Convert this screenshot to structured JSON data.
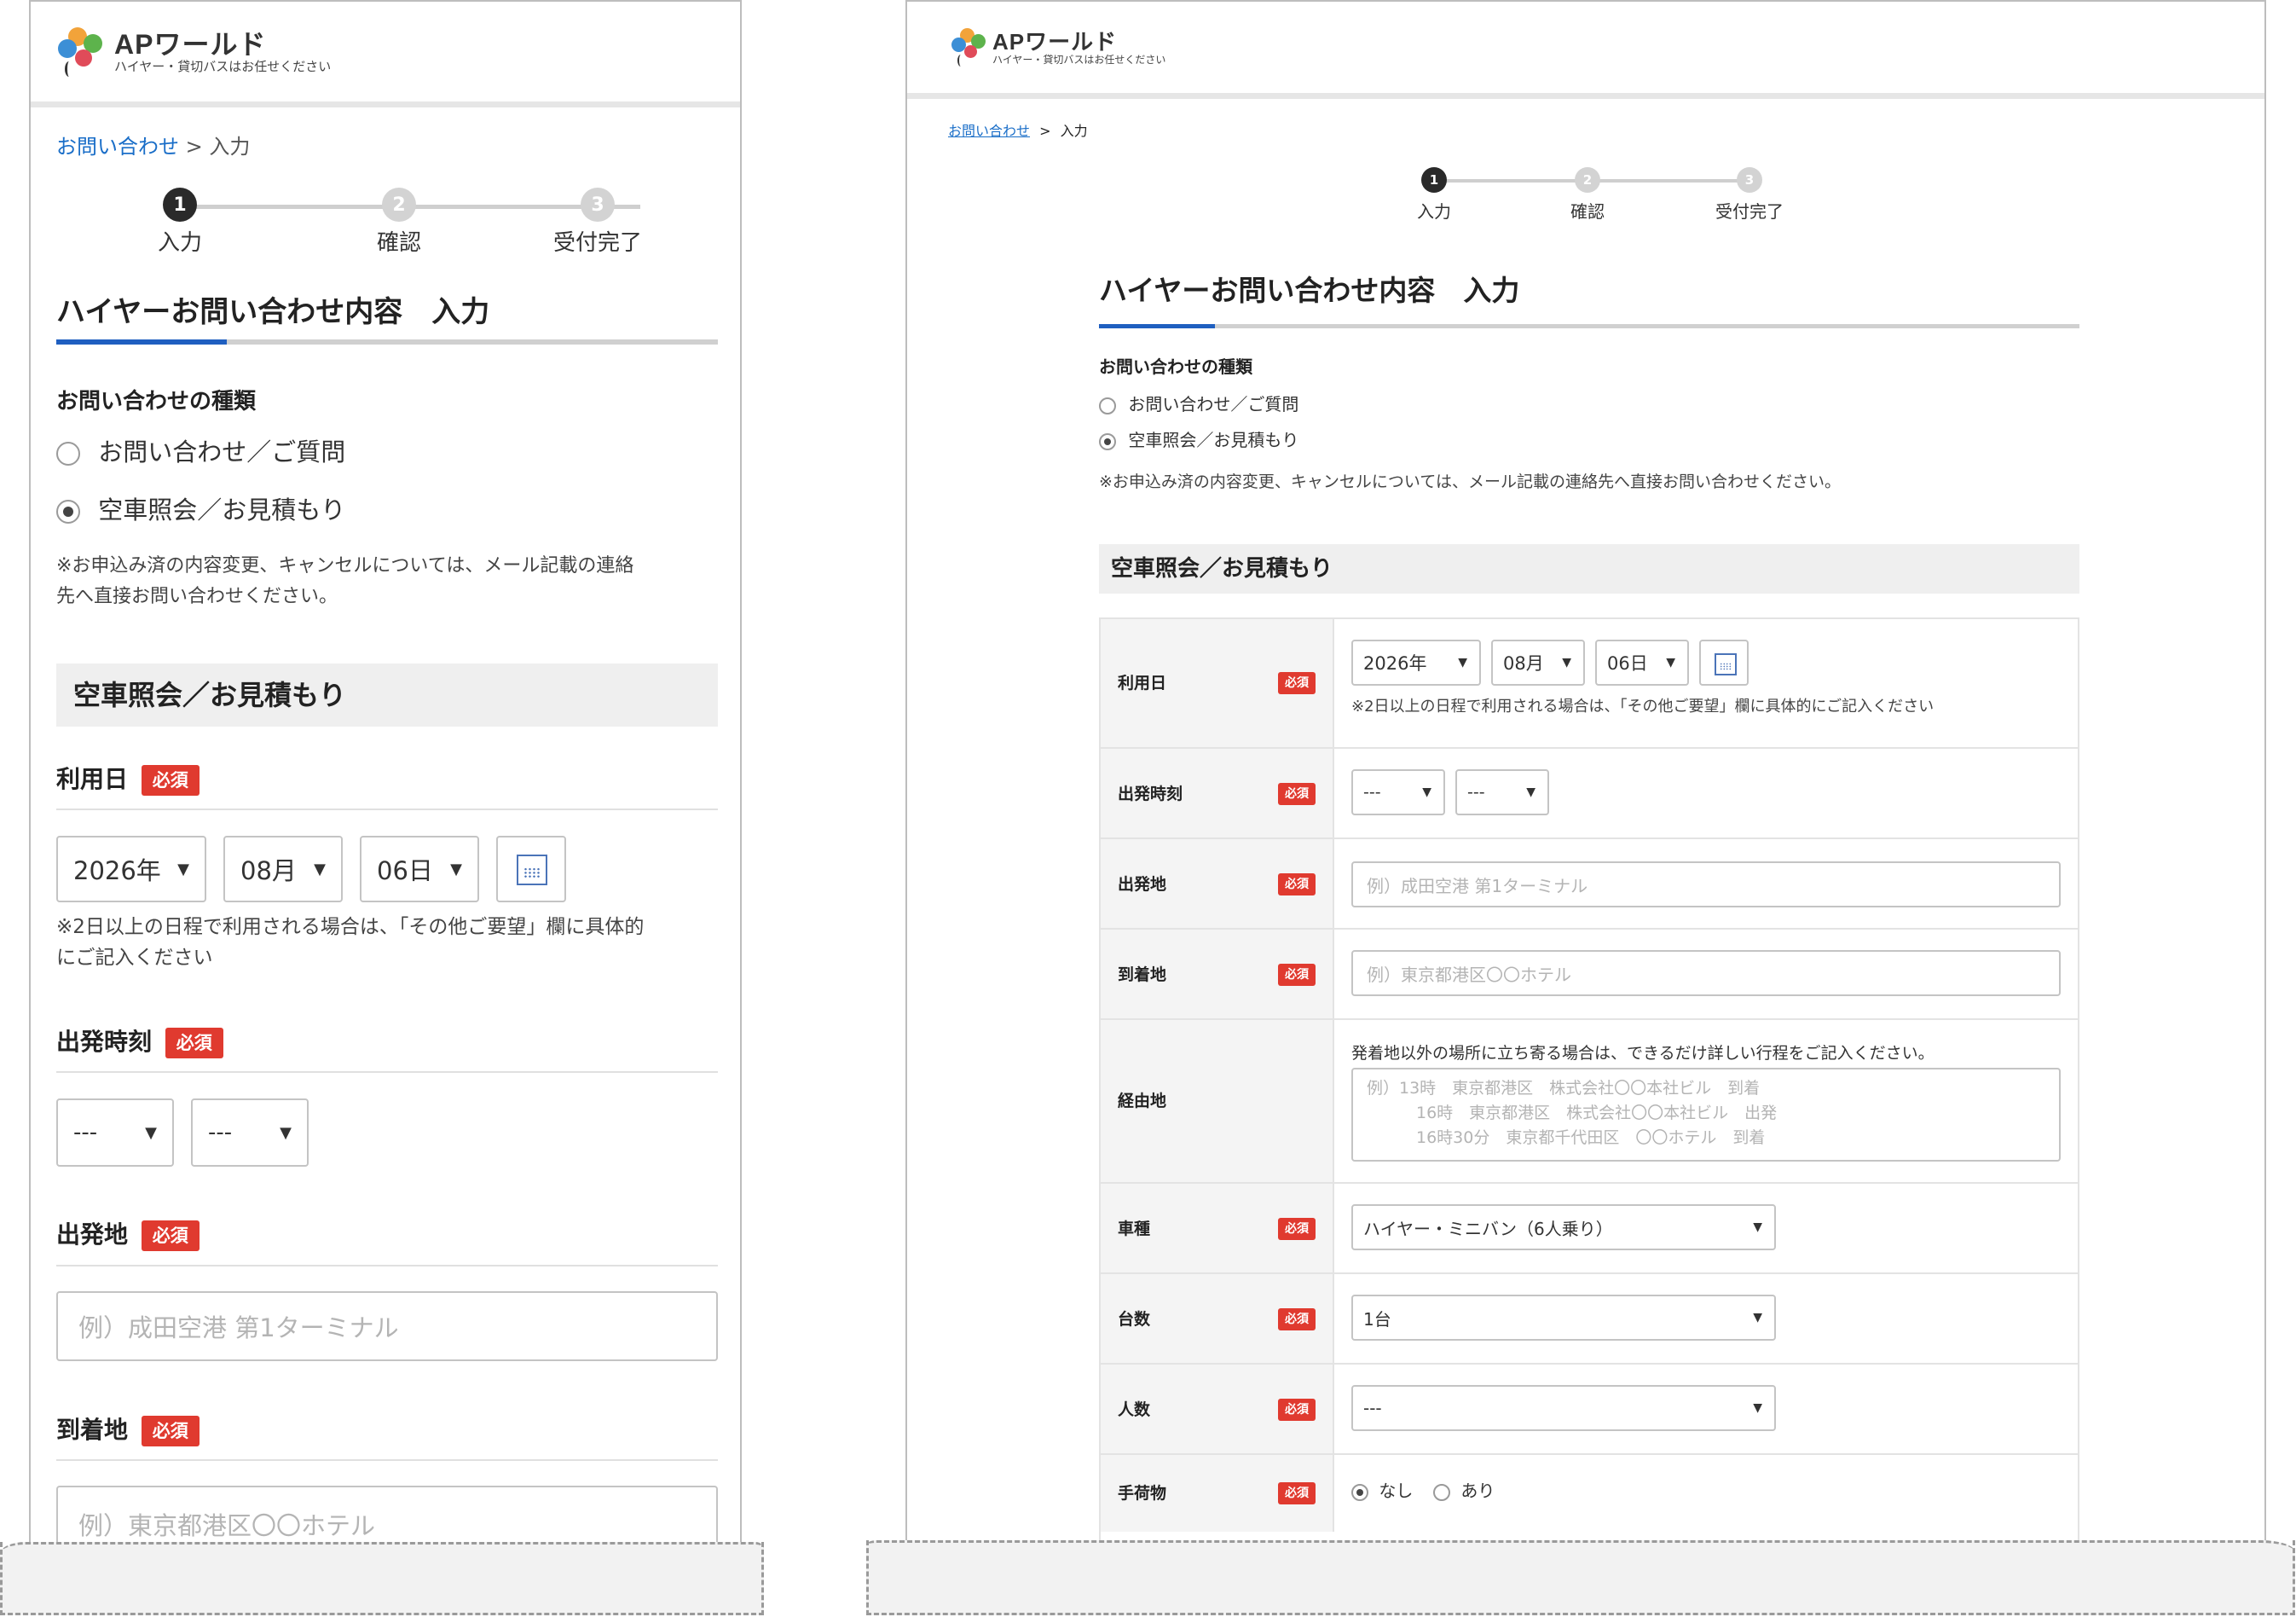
{
  "header": {
    "brand": "APワールド",
    "tagline": "ハイヤー・貸切バスはお任せください"
  },
  "breadcrumb": {
    "link": "お問い合わせ",
    "separator": ">",
    "current": "入力"
  },
  "steps": [
    {
      "num": "1",
      "label": "入力",
      "state": "active"
    },
    {
      "num": "2",
      "label": "確認",
      "state": "inactive"
    },
    {
      "num": "3",
      "label": "受付完了",
      "state": "inactive"
    }
  ],
  "page_title": "ハイヤーお問い合わせ内容　入力",
  "inquiry_type": {
    "label": "お問い合わせの種類",
    "options": [
      {
        "label": "お問い合わせ／ご質問",
        "checked": false
      },
      {
        "label": "空車照会／お見積もり",
        "checked": true
      }
    ],
    "note": "※お申込み済の内容変更、キャンセルについては、メール記載の連絡先へ直接お問い合わせください。",
    "note_mobile_line1": "※お申込み済の内容変更、キャンセルについては、メール記載の連絡",
    "note_mobile_line2": "先へ直接お問い合わせください。"
  },
  "section_title": "空車照会／お見積もり",
  "required_badge": "必須",
  "fields": {
    "date": {
      "label": "利用日",
      "year": "2026年",
      "month": "08月",
      "day": "06日",
      "note": "※2日以上の日程で利用される場合は、「その他ご要望」欄に具体的にご記入ください",
      "note_mobile_line1": "※2日以上の日程で利用される場合は、「その他ご要望」欄に具体的",
      "note_mobile_line2": "にご記入ください"
    },
    "departure_time": {
      "label": "出発時刻",
      "hour": "---",
      "minute": "---"
    },
    "departure_place": {
      "label": "出発地",
      "placeholder": "例）成田空港 第1ターミナル"
    },
    "arrival_place": {
      "label": "到着地",
      "placeholder": "例）東京都港区〇〇ホテル"
    },
    "via": {
      "label": "経由地",
      "note": "発着地以外の場所に立ち寄る場合は、できるだけ詳しい行程をご記入ください。",
      "placeholder_line1": "例）13時　東京都港区　株式会社〇〇本社ビル　到着",
      "placeholder_line2": "16時　東京都港区　株式会社〇〇本社ビル　出発",
      "placeholder_line3": "16時30分　東京都千代田区　〇〇ホテル　到着"
    },
    "vehicle_type": {
      "label": "車種",
      "value": "ハイヤー・ミニバン（6人乗り）"
    },
    "count": {
      "label": "台数",
      "value": "1台"
    },
    "people": {
      "label": "人数",
      "value": "---"
    },
    "luggage": {
      "label": "手荷物",
      "options": [
        {
          "label": "なし",
          "checked": true
        },
        {
          "label": "あり",
          "checked": false
        }
      ]
    }
  },
  "caret": "▼",
  "colors": {
    "accent": "#1f5fc0",
    "required": "#e03a2f",
    "link": "#1a6ec8"
  }
}
